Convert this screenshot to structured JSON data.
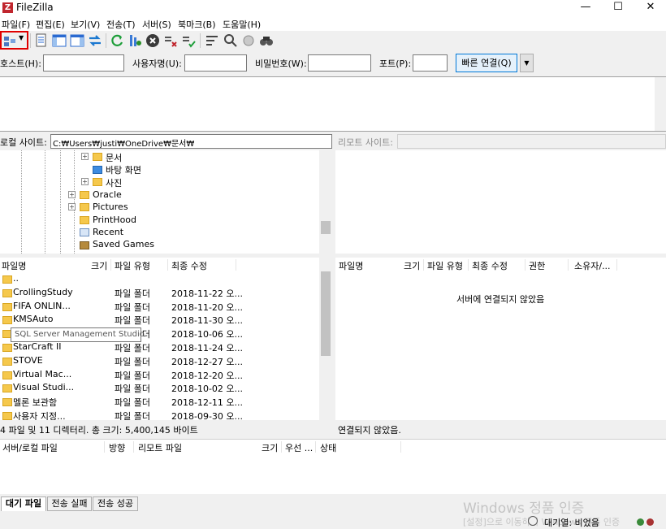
{
  "window": {
    "title": "FileZilla"
  },
  "menu": [
    "파일(F)",
    "편집(E)",
    "보기(V)",
    "전송(T)",
    "서버(S)",
    "북마크(B)",
    "도움말(H)"
  ],
  "toolbar_icons": [
    "site-manager-icon",
    "message-log-icon",
    "local-tree-icon",
    "remote-tree-icon",
    "transfer-queue-icon",
    "refresh-icon",
    "process-queue-icon",
    "cancel-icon",
    "disconnect-icon",
    "reconnect-icon",
    "directory-listing-filter-icon",
    "toggle-compare-icon",
    "sync-browse-icon",
    "search-icon"
  ],
  "quickconnect": {
    "host_label": "호스트(H):",
    "user_label": "사용자명(U):",
    "pass_label": "비밀번호(W):",
    "port_label": "포트(P):",
    "connect_label": "빠른 연결(Q)"
  },
  "local": {
    "site_label": "로컬 사이트:",
    "path": "C:₩Users₩justi₩OneDrive₩문서₩",
    "tree": [
      "문서",
      "바탕 화면",
      "사진",
      "Oracle",
      "Pictures",
      "PrintHood",
      "Recent",
      "Saved Games"
    ],
    "columns": [
      "파일명",
      "크기",
      "파일 유형",
      "최종 수정"
    ],
    "rows": [
      {
        "name": "..",
        "type": "",
        "date": ""
      },
      {
        "name": "CrollingStudy",
        "type": "파일 폴더",
        "date": "2018-11-22 오..."
      },
      {
        "name": "FIFA ONLIN...",
        "type": "파일 폴더",
        "date": "2018-11-20 오..."
      },
      {
        "name": "KMSAuto",
        "type": "파일 폴더",
        "date": "2018-11-30 오..."
      },
      {
        "name": "SQL Server ...",
        "type": "파일 폴더",
        "date": "2018-10-06 오..."
      },
      {
        "name": "StarCraft II",
        "type": "파일 폴더",
        "date": "2018-11-24 오..."
      },
      {
        "name": "STOVE",
        "type": "파일 폴더",
        "date": "2018-12-27 오..."
      },
      {
        "name": "Virtual Mac...",
        "type": "파일 폴더",
        "date": "2018-12-20 오..."
      },
      {
        "name": "Visual Studi...",
        "type": "파일 폴더",
        "date": "2018-10-02 오..."
      },
      {
        "name": "멜론 보관함",
        "type": "파일 폴더",
        "date": "2018-12-11 오..."
      },
      {
        "name": "사용자 지정...",
        "type": "파일 폴더",
        "date": "2018-09-30 오..."
      }
    ],
    "tooltip": "SQL Server Management Studio",
    "status": "4 파일 및 11 디렉터리. 총 크기: 5,400,145 바이트"
  },
  "remote": {
    "site_label": "리모트 사이트:",
    "columns": [
      "파일명",
      "크기",
      "파일 유형",
      "최종 수정",
      "권한",
      "소유자/..."
    ],
    "empty_message": "서버에 연결되지 않았음",
    "status": "연결되지 않았음."
  },
  "queue": {
    "columns": [
      "서버/로컬 파일",
      "방향",
      "리모트 파일",
      "크기",
      "우선 ...",
      "상태"
    ],
    "tabs": [
      "대기 파일",
      "전송 실패",
      "전송 성공"
    ]
  },
  "statusbar": {
    "queue_text": "대기열: 비었음",
    "watermark_title": "Windows 정품 인증",
    "watermark_sub": "[설정]으로 이동하여 Windows 정품 인증"
  }
}
